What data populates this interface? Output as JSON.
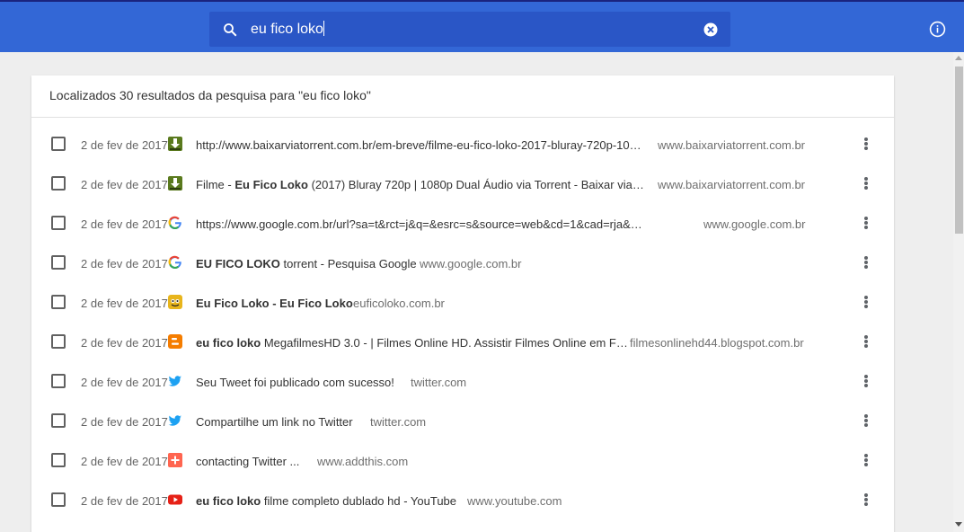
{
  "search": {
    "query": "eu fico loko"
  },
  "summary": "Localizados 30 resultados da pesquisa para \"eu fico loko\"",
  "colors": {
    "header": "#3367d6",
    "search_bg": "#2a56c6"
  },
  "rows": [
    {
      "date": "2 de fev de 2017",
      "favicon": "download-icon",
      "title_bold": "",
      "title_rest": "http://www.baixarviatorrent.com.br/em-breve/filme-eu-fico-loko-2017-bluray-720p-10…",
      "domain": "www.baixarviatorrent.com.br"
    },
    {
      "date": "2 de fev de 2017",
      "favicon": "download-icon",
      "title_pre": "Filme - ",
      "title_bold": "Eu Fico Loko",
      "title_rest": " (2017) Bluray 720p | 1080p Dual Áudio via Torrent - Baixar via T…",
      "domain": "www.baixarviatorrent.com.br"
    },
    {
      "date": "2 de fev de 2017",
      "favicon": "google-icon",
      "title_bold": "",
      "title_rest": "https://www.google.com.br/url?sa=t&rct=j&q=&esrc=s&source=web&cd=1&cad=rja&uact=8&…",
      "domain": "www.google.com.br"
    },
    {
      "date": "2 de fev de 2017",
      "favicon": "google-icon",
      "title_bold": "EU FICO LOKO",
      "title_rest": " torrent - Pesquisa Google",
      "domain": "www.google.com.br"
    },
    {
      "date": "2 de fev de 2017",
      "favicon": "euficoloko-icon",
      "title_bold": "Eu Fico Loko - Eu Fico Loko",
      "title_rest": "",
      "domain": "euficoloko.com.br"
    },
    {
      "date": "2 de fev de 2017",
      "favicon": "blogger-icon",
      "title_bold": "eu fico loko",
      "title_rest": " MegafilmesHD 3.0 - | Filmes Online HD. Assistir Filmes Online em F…",
      "domain": "filmesonlinehd44.blogspot.com.br"
    },
    {
      "date": "2 de fev de 2017",
      "favicon": "twitter-icon",
      "title_bold": "",
      "title_rest": "Seu Tweet foi publicado com sucesso!",
      "domain": "twitter.com"
    },
    {
      "date": "2 de fev de 2017",
      "favicon": "twitter-icon",
      "title_bold": "",
      "title_rest": "Compartilhe um link no Twitter",
      "domain": "twitter.com"
    },
    {
      "date": "2 de fev de 2017",
      "favicon": "addthis-icon",
      "title_bold": "",
      "title_rest": "contacting Twitter ...",
      "domain": "www.addthis.com"
    },
    {
      "date": "2 de fev de 2017",
      "favicon": "youtube-icon",
      "title_bold": "eu fico loko",
      "title_rest": " filme completo dublado hd - YouTube",
      "domain": "www.youtube.com"
    }
  ]
}
